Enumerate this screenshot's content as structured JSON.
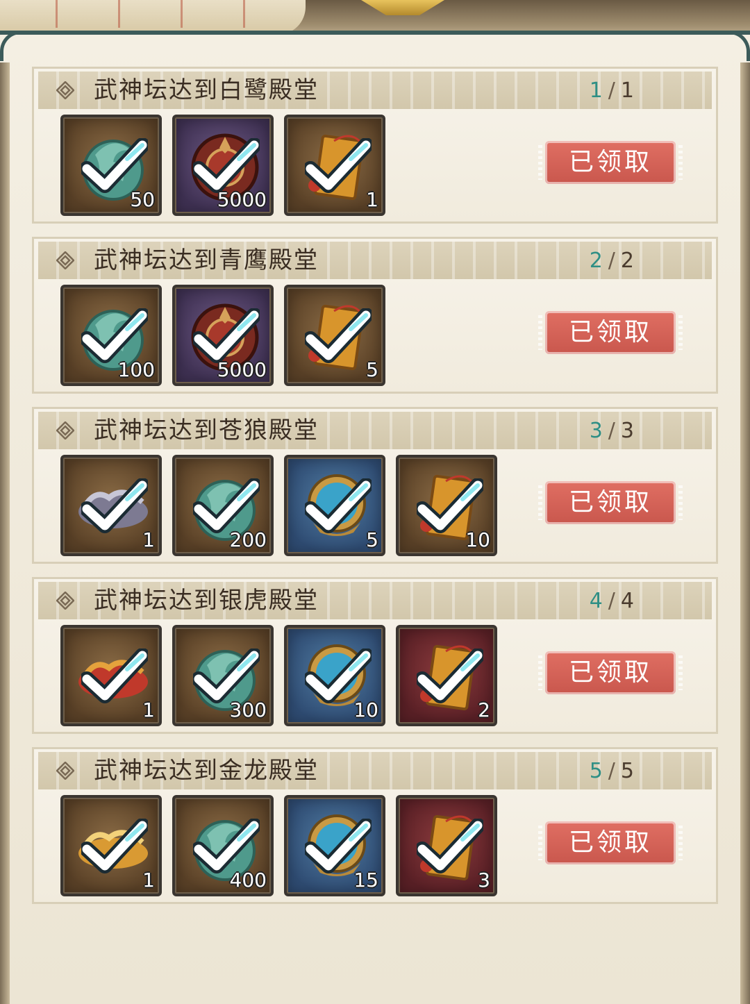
{
  "tasks": [
    {
      "title": "武神坛达到白鹭殿堂",
      "progress_current": "1",
      "progress_total": "1",
      "status": "已领取",
      "rewards": [
        {
          "icon": "jade-dragon-token-icon",
          "bg": "bronze",
          "count": "50"
        },
        {
          "icon": "bronze-coin-icon",
          "bg": "purple",
          "count": "5000"
        },
        {
          "icon": "red-pouch-icon",
          "bg": "bronze",
          "count": "1"
        }
      ]
    },
    {
      "title": "武神坛达到青鹰殿堂",
      "progress_current": "2",
      "progress_total": "2",
      "status": "已领取",
      "rewards": [
        {
          "icon": "jade-dragon-token-icon",
          "bg": "bronze",
          "count": "100"
        },
        {
          "icon": "bronze-coin-icon",
          "bg": "purple",
          "count": "5000"
        },
        {
          "icon": "red-pouch-icon",
          "bg": "bronze",
          "count": "5"
        }
      ]
    },
    {
      "title": "武神坛达到苍狼殿堂",
      "progress_current": "3",
      "progress_total": "3",
      "status": "已领取",
      "rewards": [
        {
          "icon": "wolf-mount-icon",
          "bg": "bronze",
          "count": "1"
        },
        {
          "icon": "jade-dragon-token-icon",
          "bg": "bronze",
          "count": "200"
        },
        {
          "icon": "blue-orb-emblem-icon",
          "bg": "blue",
          "count": "5"
        },
        {
          "icon": "red-pouch-icon",
          "bg": "bronze",
          "count": "10"
        }
      ]
    },
    {
      "title": "武神坛达到银虎殿堂",
      "progress_current": "4",
      "progress_total": "4",
      "status": "已领取",
      "rewards": [
        {
          "icon": "tiger-mount-icon",
          "bg": "bronze",
          "count": "1"
        },
        {
          "icon": "jade-dragon-token-icon",
          "bg": "bronze",
          "count": "300"
        },
        {
          "icon": "blue-orb-emblem-icon",
          "bg": "blue",
          "count": "10"
        },
        {
          "icon": "red-pouch-icon",
          "bg": "red",
          "count": "2"
        }
      ]
    },
    {
      "title": "武神坛达到金龙殿堂",
      "progress_current": "5",
      "progress_total": "5",
      "status": "已领取",
      "rewards": [
        {
          "icon": "golden-dragon-mount-icon",
          "bg": "bronze",
          "count": "1"
        },
        {
          "icon": "jade-dragon-token-icon",
          "bg": "bronze",
          "count": "400"
        },
        {
          "icon": "blue-orb-emblem-icon",
          "bg": "blue",
          "count": "15"
        },
        {
          "icon": "red-pouch-icon",
          "bg": "red",
          "count": "3"
        }
      ]
    }
  ],
  "colors": {
    "progress_current": "#2f8f85",
    "claimed_badge": "#d4635a"
  }
}
